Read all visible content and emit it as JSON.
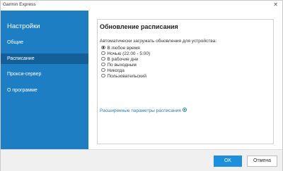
{
  "window": {
    "title": "Garmin Express",
    "close_glyph": "✕"
  },
  "sidebar": {
    "heading": "Настройки",
    "items": [
      {
        "label": "Общие"
      },
      {
        "label": "Расписание"
      },
      {
        "label": "Прокси-сервер"
      },
      {
        "label": "О программе"
      }
    ]
  },
  "panel": {
    "title": "Обновление расписания",
    "prompt": "Автоматически загружать обновления для устройства:",
    "options": [
      {
        "label": "В любое время"
      },
      {
        "label": "Ночью (22:00 - 5:00)"
      },
      {
        "label": "В рабочие дни"
      },
      {
        "label": "По выходным"
      },
      {
        "label": "Никогда"
      },
      {
        "label": "Пользовательский"
      }
    ],
    "advanced_link": "Расширенные параметры расписания"
  },
  "footer": {
    "ok_label": "OK",
    "cancel_label": "Отмена"
  },
  "colors": {
    "accent": "#1d7ec3",
    "sidebar_active": "#145f97",
    "ok_button": "#1d8fe1"
  }
}
